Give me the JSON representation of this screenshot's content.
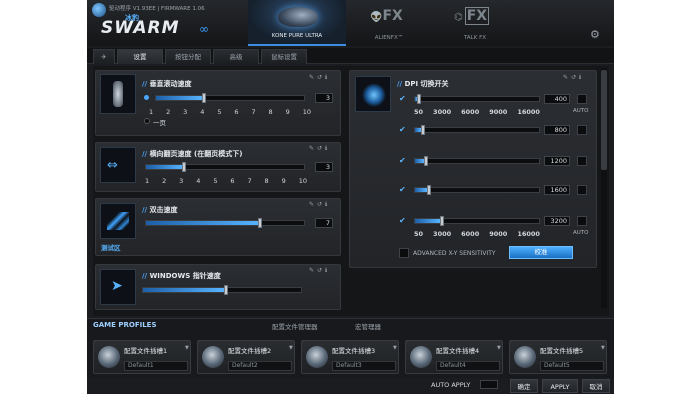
{
  "header": {
    "version": "驱动程序 V1.93EE | FIRMWARE 1.06",
    "brand": "SWARM",
    "brand_cn": "冰豹",
    "device_tabs": [
      {
        "label": "KONE PURE ULTRA"
      },
      {
        "label": "ALIENFX™",
        "mark": "FX"
      },
      {
        "label": "TALK FX",
        "mark": "FX"
      }
    ]
  },
  "subtabs": [
    "设置",
    "按钮分配",
    "高级",
    "鼠标设置"
  ],
  "panels": {
    "vertical_scroll": {
      "title": "垂直滚动速度",
      "value": "3",
      "ticks": [
        "1",
        "2",
        "3",
        "4",
        "5",
        "6",
        "7",
        "8",
        "9",
        "10"
      ],
      "option": "一页"
    },
    "horizontal_scroll": {
      "title": "横向翻页速度 (在翻页模式下)",
      "value": "3",
      "ticks": [
        "1",
        "2",
        "3",
        "4",
        "5",
        "6",
        "7",
        "8",
        "9",
        "10"
      ]
    },
    "double_click": {
      "title": "双击速度",
      "value": "7",
      "thumb_label": "测试区"
    },
    "windows_pointer": {
      "title": "WINDOWS 指针速度"
    },
    "dpi": {
      "title": "DPI 切换开关",
      "rows": [
        {
          "value": "400",
          "level": 0.0,
          "checked": true,
          "ticks": [
            "50",
            "3000",
            "6000",
            "9000",
            "16000"
          ],
          "auto": "AUTO"
        },
        {
          "value": "800",
          "level": 0.05,
          "checked": true
        },
        {
          "value": "1200",
          "level": 0.07,
          "checked": true
        },
        {
          "value": "1600",
          "level": 0.1,
          "checked": true
        },
        {
          "value": "3200",
          "level": 0.2,
          "checked": true,
          "ticks": [
            "50",
            "3000",
            "6000",
            "9000",
            "16000"
          ],
          "auto": "AUTO"
        }
      ],
      "advanced": "ADVANCED X-Y SENSITIVITY",
      "apply_button": "校准"
    }
  },
  "profiles": {
    "title": "GAME PROFILES",
    "menu": [
      "配置文件管理器",
      "宏管理器"
    ],
    "slots": [
      {
        "name": "配置文件插槽1",
        "default": "Default1"
      },
      {
        "name": "配置文件插槽2",
        "default": "Default2"
      },
      {
        "name": "配置文件插槽3",
        "default": "Default3"
      },
      {
        "name": "配置文件插槽4",
        "default": "Default4"
      },
      {
        "name": "配置文件插槽5",
        "default": "Default5"
      }
    ]
  },
  "footer": {
    "auto_apply": "AUTO APPLY",
    "ok": "确定",
    "apply": "APPLY",
    "cancel": "取消"
  }
}
